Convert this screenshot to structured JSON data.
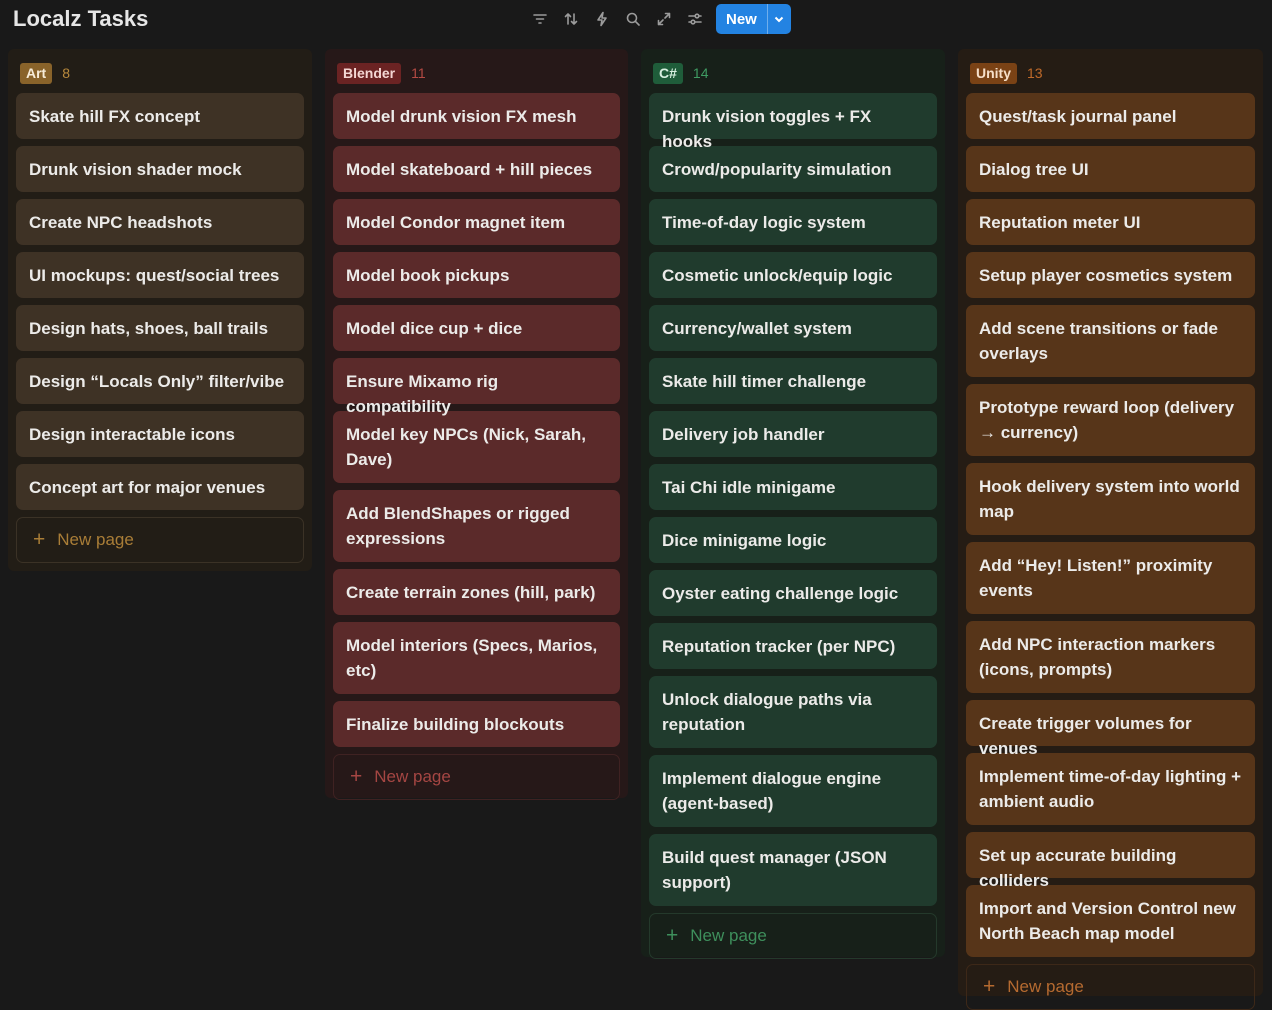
{
  "app": {
    "title": "Localz Tasks"
  },
  "toolbar": {
    "icons": [
      "filter-icon",
      "sort-icon",
      "lightning-icon",
      "search-icon",
      "expand-icon",
      "settings-sliders-icon"
    ],
    "new_label": "New"
  },
  "columns": {
    "art": {
      "tag": "Art",
      "count": "8",
      "cards": [
        "Skate hill FX concept",
        "Drunk vision shader mock",
        "Create NPC headshots",
        "UI mockups: quest/social trees",
        "Design hats, shoes, ball trails",
        "Design “Locals Only” filter/vibe",
        "Design interactable icons",
        "Concept art for major venues"
      ],
      "new_page": "New page"
    },
    "blender": {
      "tag": "Blender",
      "count": "11",
      "cards": [
        "Model drunk vision FX mesh",
        "Model skateboard + hill pieces",
        "Model Condor magnet item",
        "Model book pickups",
        "Model dice cup + dice",
        "Ensure Mixamo rig compatibility",
        "Model key NPCs (Nick, Sarah, Dave)",
        "Add BlendShapes or rigged expressions",
        "Create terrain zones (hill, park)",
        "Model interiors (Specs, Marios, etc)",
        "Finalize building blockouts"
      ],
      "new_page": "New page"
    },
    "csharp": {
      "tag": "C#",
      "count": "14",
      "cards": [
        "Drunk vision toggles + FX hooks",
        "Crowd/popularity simulation",
        "Time-of-day logic system",
        "Cosmetic unlock/equip logic",
        "Currency/wallet system",
        "Skate hill timer challenge",
        "Delivery job handler",
        "Tai Chi idle minigame",
        "Dice minigame logic",
        "Oyster eating challenge logic",
        "Reputation tracker (per NPC)",
        "Unlock dialogue paths via reputation",
        "Implement dialogue engine (agent-based)",
        "Build quest manager (JSON support)"
      ],
      "new_page": "New page"
    },
    "unity": {
      "tag": "Unity",
      "count": "13",
      "cards": [
        "Quest/task journal panel",
        "Dialog tree UI",
        "Reputation meter UI",
        "Setup player cosmetics system",
        "Add scene transitions or fade overlays",
        "Prototype reward loop (delivery → currency)",
        "Hook delivery system into world map",
        "Add “Hey! Listen!” proximity events",
        "Add NPC interaction markers (icons, prompts)",
        "Create trigger volumes for venues",
        "Implement time-of-day lighting + ambient audio",
        "Set up accurate building colliders",
        "Import and Version Control new North Beach map model"
      ],
      "new_page": "New page"
    }
  }
}
